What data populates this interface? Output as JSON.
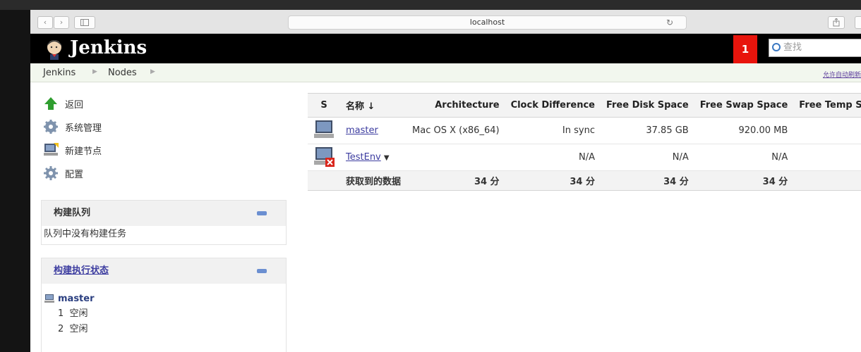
{
  "browser": {
    "url": "localhost"
  },
  "header": {
    "brand": "Jenkins",
    "notification_count": "1",
    "search_placeholder": "查找"
  },
  "breadcrumbs": [
    {
      "label": "Jenkins"
    },
    {
      "label": "Nodes"
    }
  ],
  "auto_refresh_label": "允许自动刷新",
  "side_tasks": [
    {
      "label": "返回",
      "icon": "up-arrow-icon"
    },
    {
      "label": "系统管理",
      "icon": "gear-icon"
    },
    {
      "label": "新建节点",
      "icon": "computer-icon"
    },
    {
      "label": "配置",
      "icon": "gear-icon"
    }
  ],
  "build_queue": {
    "title": "构建队列",
    "empty_message": "队列中没有构建任务"
  },
  "executor_status": {
    "title": "构建执行状态",
    "node": "master",
    "executors": [
      {
        "number": "1",
        "status": "空闲"
      },
      {
        "number": "2",
        "status": "空闲"
      }
    ]
  },
  "node_table": {
    "columns": [
      "S",
      "名称 ↓",
      "Architecture",
      "Clock Difference",
      "Free Disk Space",
      "Free Swap Space",
      "Free Temp Space"
    ],
    "rows": [
      {
        "name": "master",
        "architecture": "Mac OS X (x86_64)",
        "clock_difference": "In sync",
        "free_disk": "37.85 GB",
        "free_swap": "920.00 MB",
        "free_temp": "",
        "offline": false
      },
      {
        "name": "TestEnv",
        "architecture": "",
        "clock_difference": "N/A",
        "free_disk": "N/A",
        "free_swap": "N/A",
        "free_temp": "",
        "offline": true
      }
    ],
    "footer": {
      "label": "获取到的数据",
      "architecture": "34 分",
      "clock_difference": "34 分",
      "free_disk": "34 分",
      "free_swap": "34 分"
    }
  },
  "colors": {
    "header_bg": "#000000",
    "notification_bg": "#e8140c",
    "breadcrumb_bg": "#f2f7ee",
    "link": "#3d3da0"
  }
}
